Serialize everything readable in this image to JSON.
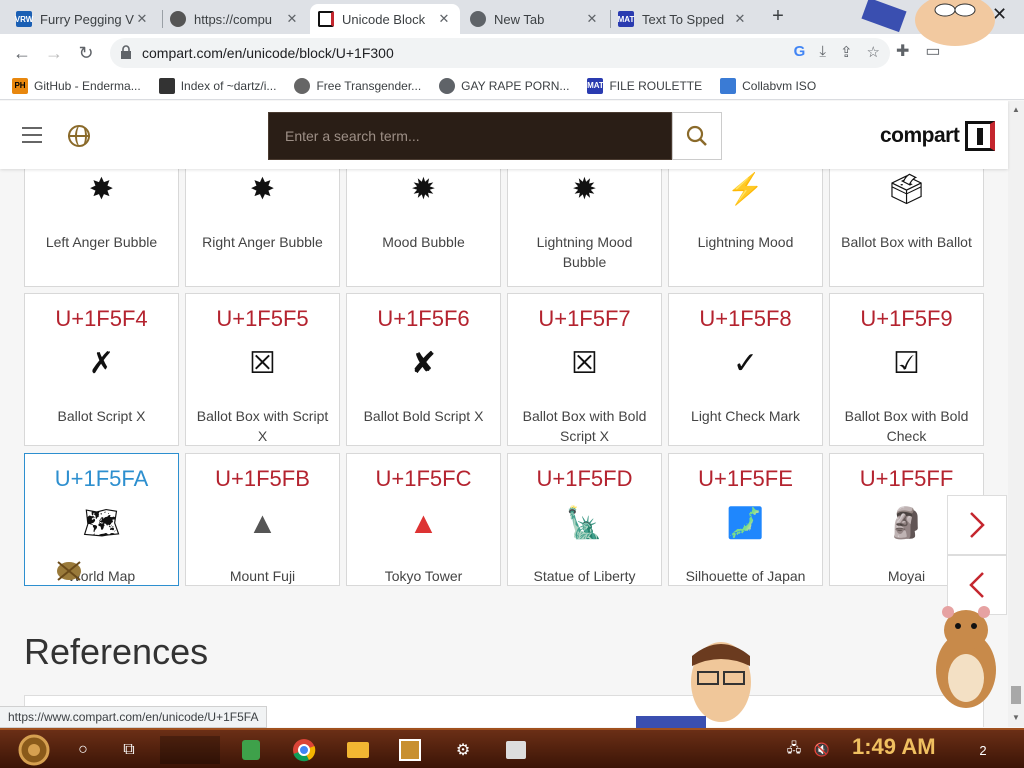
{
  "tabs": [
    {
      "title": "Furry Pegging V",
      "favicon_color": "#1a5fb4",
      "favicon_text": "VRW"
    },
    {
      "title": "https://compu",
      "favicon_color": "#555555",
      "favicon_text": ""
    },
    {
      "title": "Unicode Block",
      "favicon_color": "#111111",
      "favicon_text": ""
    },
    {
      "title": "New Tab",
      "favicon_color": "#5f6368",
      "favicon_text": ""
    },
    {
      "title": "Text To Spped",
      "favicon_color": "#2a3bb0",
      "favicon_text": "MAT"
    }
  ],
  "address": {
    "url": "compart.com/en/unicode/block/U+1F300"
  },
  "bookmarks": [
    {
      "label": "GitHub - Enderma...",
      "icon_color": "#e8870e",
      "icon_text": "PH"
    },
    {
      "label": "Index of ~dartz/i...",
      "icon_color": "#333333",
      "icon_text": ""
    },
    {
      "label": "Free Transgender...",
      "icon_color": "#666666",
      "icon_text": ""
    },
    {
      "label": "GAY RAPE PORN...",
      "icon_color": "#5f6368",
      "icon_text": ""
    },
    {
      "label": "FILE ROULETTE",
      "icon_color": "#2a3bb0",
      "icon_text": "MAT"
    },
    {
      "label": "Collabvm ISO",
      "icon_color": "#3a7bd5",
      "icon_text": ""
    }
  ],
  "site": {
    "search_placeholder": "Enter a search term...",
    "logo_text": "compart"
  },
  "row0": [
    {
      "glyph": "✸",
      "name": "Left Anger Bubble"
    },
    {
      "glyph": "✸",
      "name": "Right Anger Bubble"
    },
    {
      "glyph": "✹",
      "name": "Mood Bubble"
    },
    {
      "glyph": "✹",
      "name": "Lightning Mood Bubble"
    },
    {
      "glyph": "⚡",
      "name": "Lightning Mood"
    },
    {
      "glyph": "🗳",
      "name": "Ballot Box with Ballot"
    }
  ],
  "row1": [
    {
      "code": "U+1F5F4",
      "glyph": "✗",
      "name": "Ballot Script X"
    },
    {
      "code": "U+1F5F5",
      "glyph": "☒",
      "name": "Ballot Box with Script X"
    },
    {
      "code": "U+1F5F6",
      "glyph": "✘",
      "name": "Ballot Bold Script X"
    },
    {
      "code": "U+1F5F7",
      "glyph": "☒",
      "name": "Ballot Box with Bold Script X"
    },
    {
      "code": "U+1F5F8",
      "glyph": "✓",
      "name": "Light Check Mark"
    },
    {
      "code": "U+1F5F9",
      "glyph": "☑",
      "name": "Ballot Box with Bold Check"
    }
  ],
  "row2": [
    {
      "code": "U+1F5FA",
      "glyph": "🗺",
      "name": "World Map"
    },
    {
      "code": "U+1F5FB",
      "glyph": "▲",
      "name": "Mount Fuji"
    },
    {
      "code": "U+1F5FC",
      "glyph": "▲",
      "name": "Tokyo Tower"
    },
    {
      "code": "U+1F5FD",
      "glyph": "🗽",
      "name": "Statue of Liberty"
    },
    {
      "code": "U+1F5FE",
      "glyph": "🗾",
      "name": "Silhouette of Japan"
    },
    {
      "code": "U+1F5FF",
      "glyph": "🗿",
      "name": "Moyai"
    }
  ],
  "references_heading": "References",
  "status_url": "https://www.compart.com/en/unicode/U+1F5FA",
  "taskbar": {
    "clock": "1:49 AM",
    "notification_count": "2"
  }
}
